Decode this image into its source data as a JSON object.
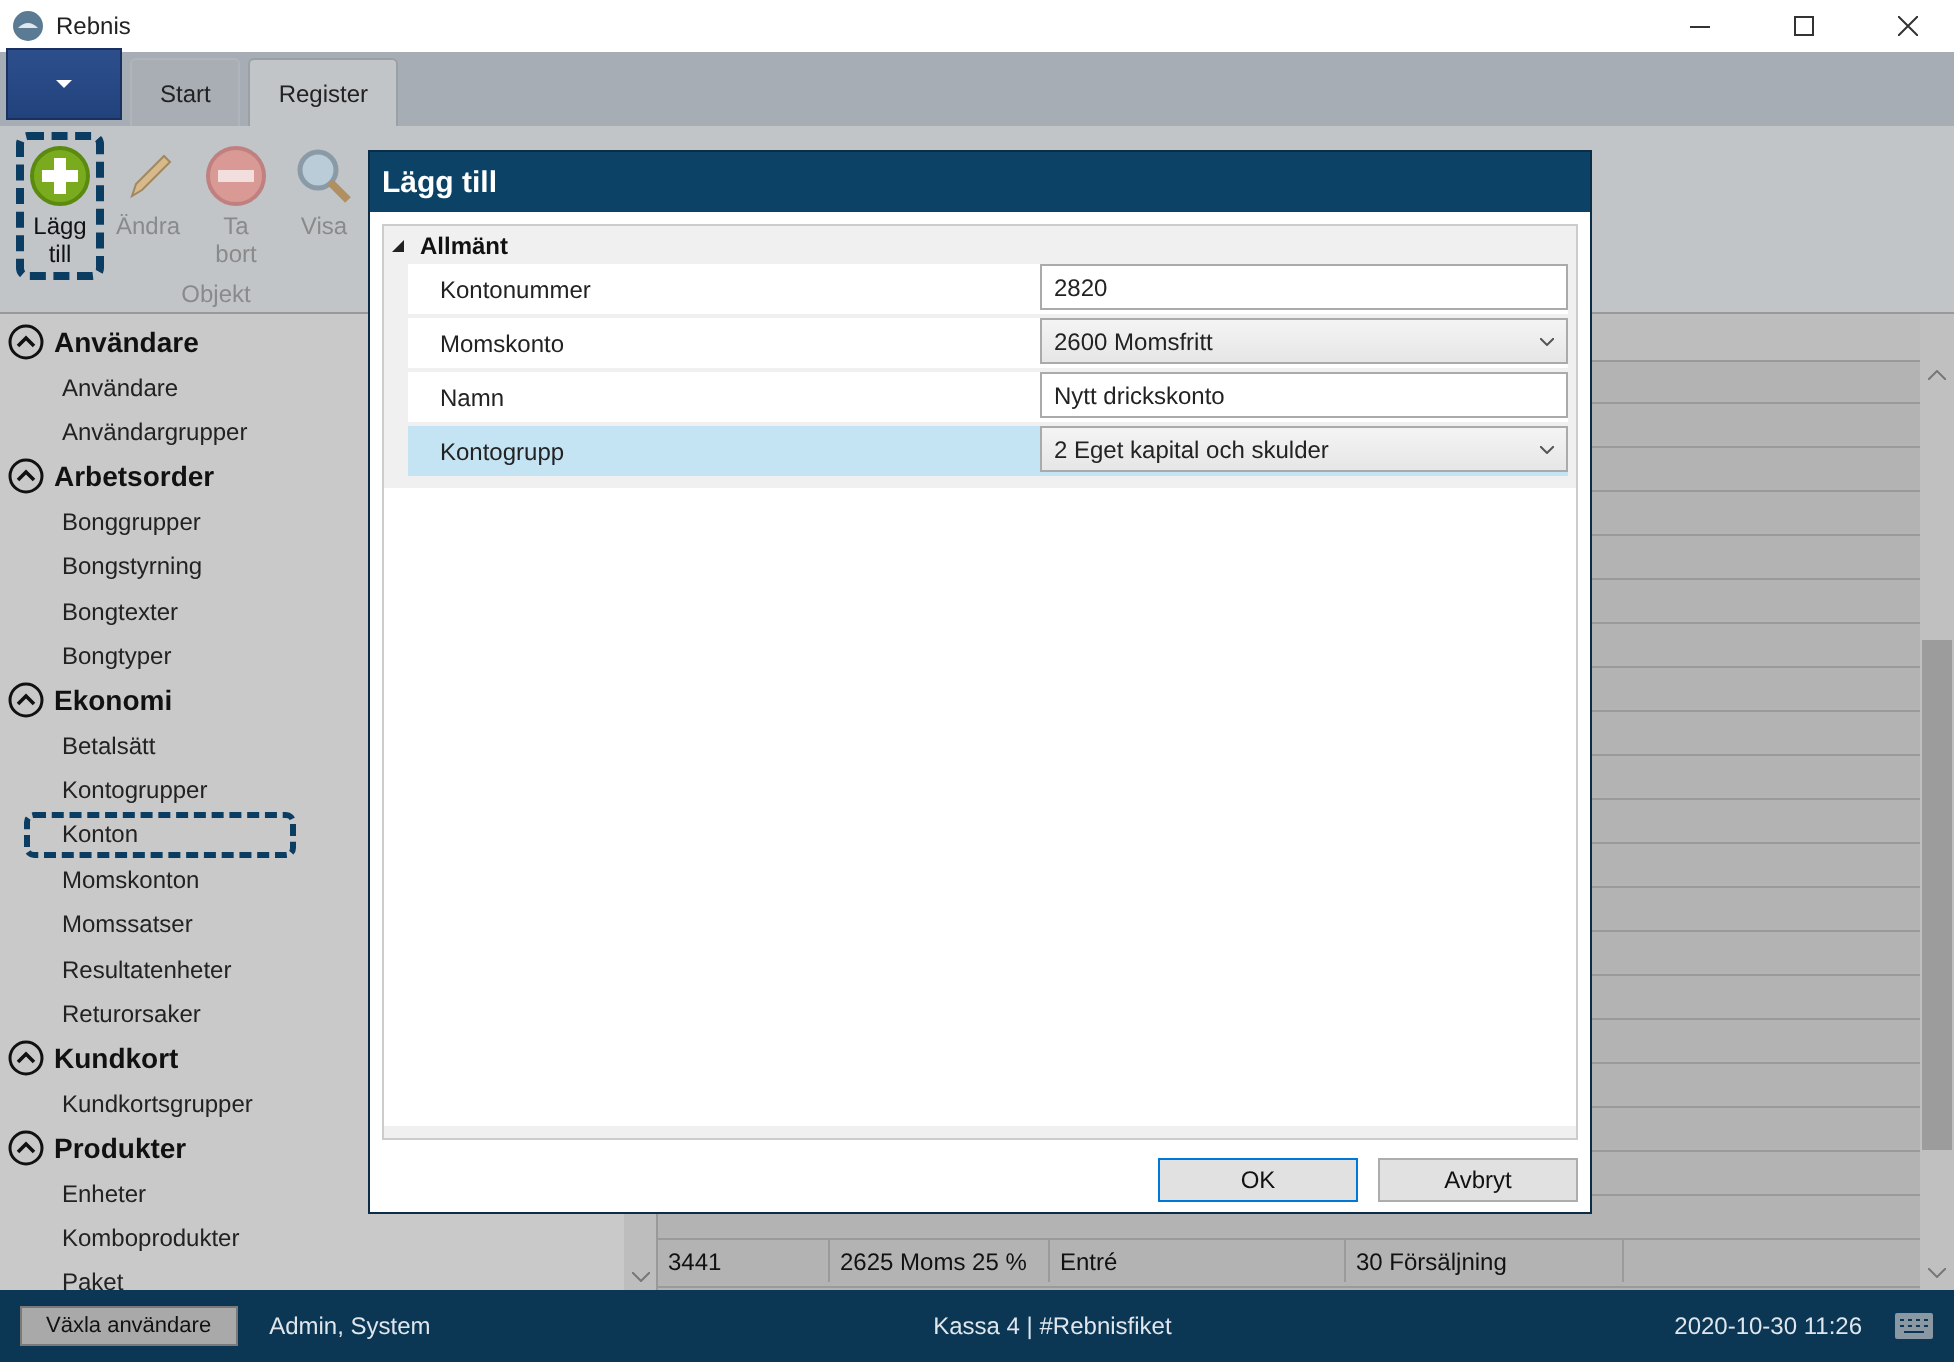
{
  "window": {
    "title": "Rebnis"
  },
  "ribbon": {
    "tabs": [
      {
        "label": "Start",
        "selected": false
      },
      {
        "label": "Register",
        "selected": true
      }
    ],
    "buttons": [
      {
        "label": "Lägg till",
        "kind": "add",
        "disabled": false,
        "focused": true
      },
      {
        "label": "Ändra",
        "kind": "edit",
        "disabled": true,
        "focused": false
      },
      {
        "label": "Ta bort",
        "kind": "remove",
        "disabled": true,
        "focused": false
      },
      {
        "label": "Visa",
        "kind": "view",
        "disabled": true,
        "focused": false
      }
    ],
    "group_label": "Objekt"
  },
  "sidebar": {
    "groups": [
      {
        "label": "Användare",
        "expanded": true,
        "children": [
          {
            "label": "Användare",
            "selected": false
          },
          {
            "label": "Användargrupper",
            "selected": false
          }
        ]
      },
      {
        "label": "Arbetsorder",
        "expanded": true,
        "children": [
          {
            "label": "Bonggrupper",
            "selected": false
          },
          {
            "label": "Bongstyrning",
            "selected": false
          },
          {
            "label": "Bongtexter",
            "selected": false
          },
          {
            "label": "Bongtyper",
            "selected": false
          }
        ]
      },
      {
        "label": "Ekonomi",
        "expanded": true,
        "children": [
          {
            "label": "Betalsätt",
            "selected": false
          },
          {
            "label": "Kontogrupper",
            "selected": false
          },
          {
            "label": "Konton",
            "selected": true
          },
          {
            "label": "Momskonton",
            "selected": false
          },
          {
            "label": "Momssatser",
            "selected": false
          },
          {
            "label": "Resultatenheter",
            "selected": false
          },
          {
            "label": "Returorsaker",
            "selected": false
          }
        ]
      },
      {
        "label": "Kundkort",
        "expanded": true,
        "children": [
          {
            "label": "Kundkortsgrupper",
            "selected": false
          }
        ]
      },
      {
        "label": "Produkter",
        "expanded": true,
        "children": [
          {
            "label": "Enheter",
            "selected": false
          },
          {
            "label": "Komboprodukter",
            "selected": false
          },
          {
            "label": "Paket",
            "selected": false
          }
        ]
      }
    ]
  },
  "table": {
    "rows": [
      {
        "cells": [
          "3441",
          "2625 Moms 25 %",
          "Entré",
          "30 Försäljning"
        ]
      }
    ]
  },
  "dialog": {
    "title": "Lägg till",
    "category": {
      "label": "Allmänt",
      "expanded": true
    },
    "properties": [
      {
        "label": "Kontonummer",
        "kind": "text",
        "value": "2820",
        "selected": false
      },
      {
        "label": "Momskonto",
        "kind": "dropdown",
        "value": "2600 Momsfritt",
        "selected": false
      },
      {
        "label": "Namn",
        "kind": "text",
        "value": "Nytt drickskonto",
        "selected": false
      },
      {
        "label": "Kontogrupp",
        "kind": "dropdown",
        "value": "2 Eget kapital och skulder",
        "selected": true
      }
    ],
    "buttons": [
      {
        "label": "OK",
        "default": true
      },
      {
        "label": "Avbryt",
        "default": false
      }
    ]
  },
  "status_bar": {
    "switch_user_button": "Växla användare",
    "user": "Admin, System",
    "register": "Kassa 4 | #Rebnisfiket",
    "datetime": "2020-10-30 11:26"
  }
}
